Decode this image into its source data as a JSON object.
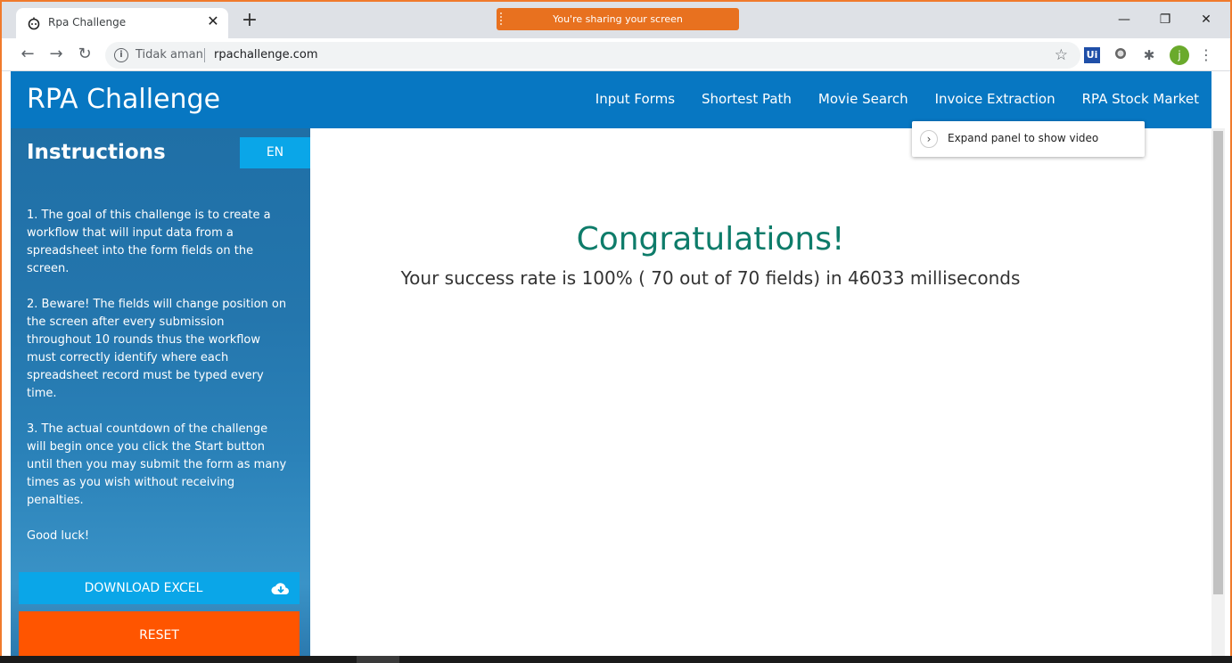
{
  "browser": {
    "tab_title": "Rpa Challenge",
    "tab_close": "✕",
    "new_tab": "+",
    "share_banner": "You're sharing your screen",
    "window_controls": [
      "—",
      "❐",
      "✕"
    ],
    "not_secure": "Tidak aman",
    "url": "rpachallenge.com",
    "extensions": [
      "Ui",
      "j"
    ]
  },
  "navbar": {
    "brand": "RPA Challenge",
    "links": [
      "Input Forms",
      "Shortest Path",
      "Movie Search",
      "Invoice Extraction",
      "RPA Stock Market"
    ]
  },
  "sidebar": {
    "title": "Instructions",
    "language": "EN",
    "instructions": [
      "1. The goal of this challenge is to create a workflow that will input data from a spreadsheet into the form fields on the screen.",
      "2. Beware! The fields will change position on the screen after every submission throughout 10 rounds thus the workflow must correctly identify where each spreadsheet record must be typed every time.",
      "3. The actual countdown of the challenge will begin once you click the Start button until then you may submit the form as many times as you wish without receiving penalties.",
      "Good luck!"
    ],
    "download_label": "DOWNLOAD EXCEL",
    "reset_label": "RESET"
  },
  "main": {
    "heading": "Congratulations!",
    "result": "Your success rate is 100% ( 70 out of 70 fields) in 46033 milliseconds"
  },
  "tooltip": {
    "text": "Expand panel to show video",
    "chevron": "›"
  },
  "colors": {
    "navbar": "#0777c2",
    "accent_button": "#0aa6e8",
    "reset_button": "#ff5500",
    "heading": "#0e7c6a",
    "share_banner": "#e8711f"
  }
}
